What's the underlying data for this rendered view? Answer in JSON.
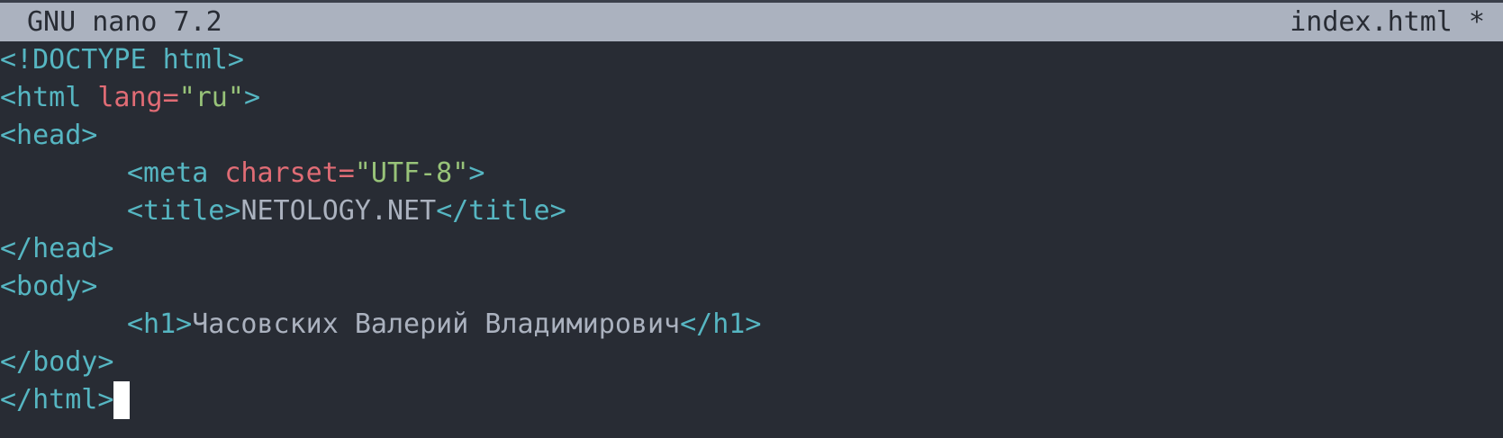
{
  "titlebar": {
    "app": "GNU nano 7.2",
    "filename": "index.html *"
  },
  "lines": {
    "l1": {
      "tag_open": "<!DOCTYPE html>"
    },
    "l2": {
      "tag_start": "<html ",
      "attr": "lang=",
      "str": "\"ru\"",
      "tag_end": ">"
    },
    "l3": {
      "tag": "<head>"
    },
    "l4": {
      "tag_start": "<meta ",
      "attr": "charset=",
      "str": "\"UTF-8\"",
      "tag_end": ">"
    },
    "l5": {
      "tag_open": "<title>",
      "text": "NETOLOGY.NET",
      "tag_close": "</title>"
    },
    "l6": {
      "tag": "</head>"
    },
    "l7": {
      "tag": "<body>"
    },
    "l8": {
      "tag_open": "<h1>",
      "text": "Часовских Валерий Владимирович",
      "tag_close": "</h1>"
    },
    "l9": {
      "tag": "</body>"
    },
    "l10": {
      "tag": "</html>"
    }
  }
}
